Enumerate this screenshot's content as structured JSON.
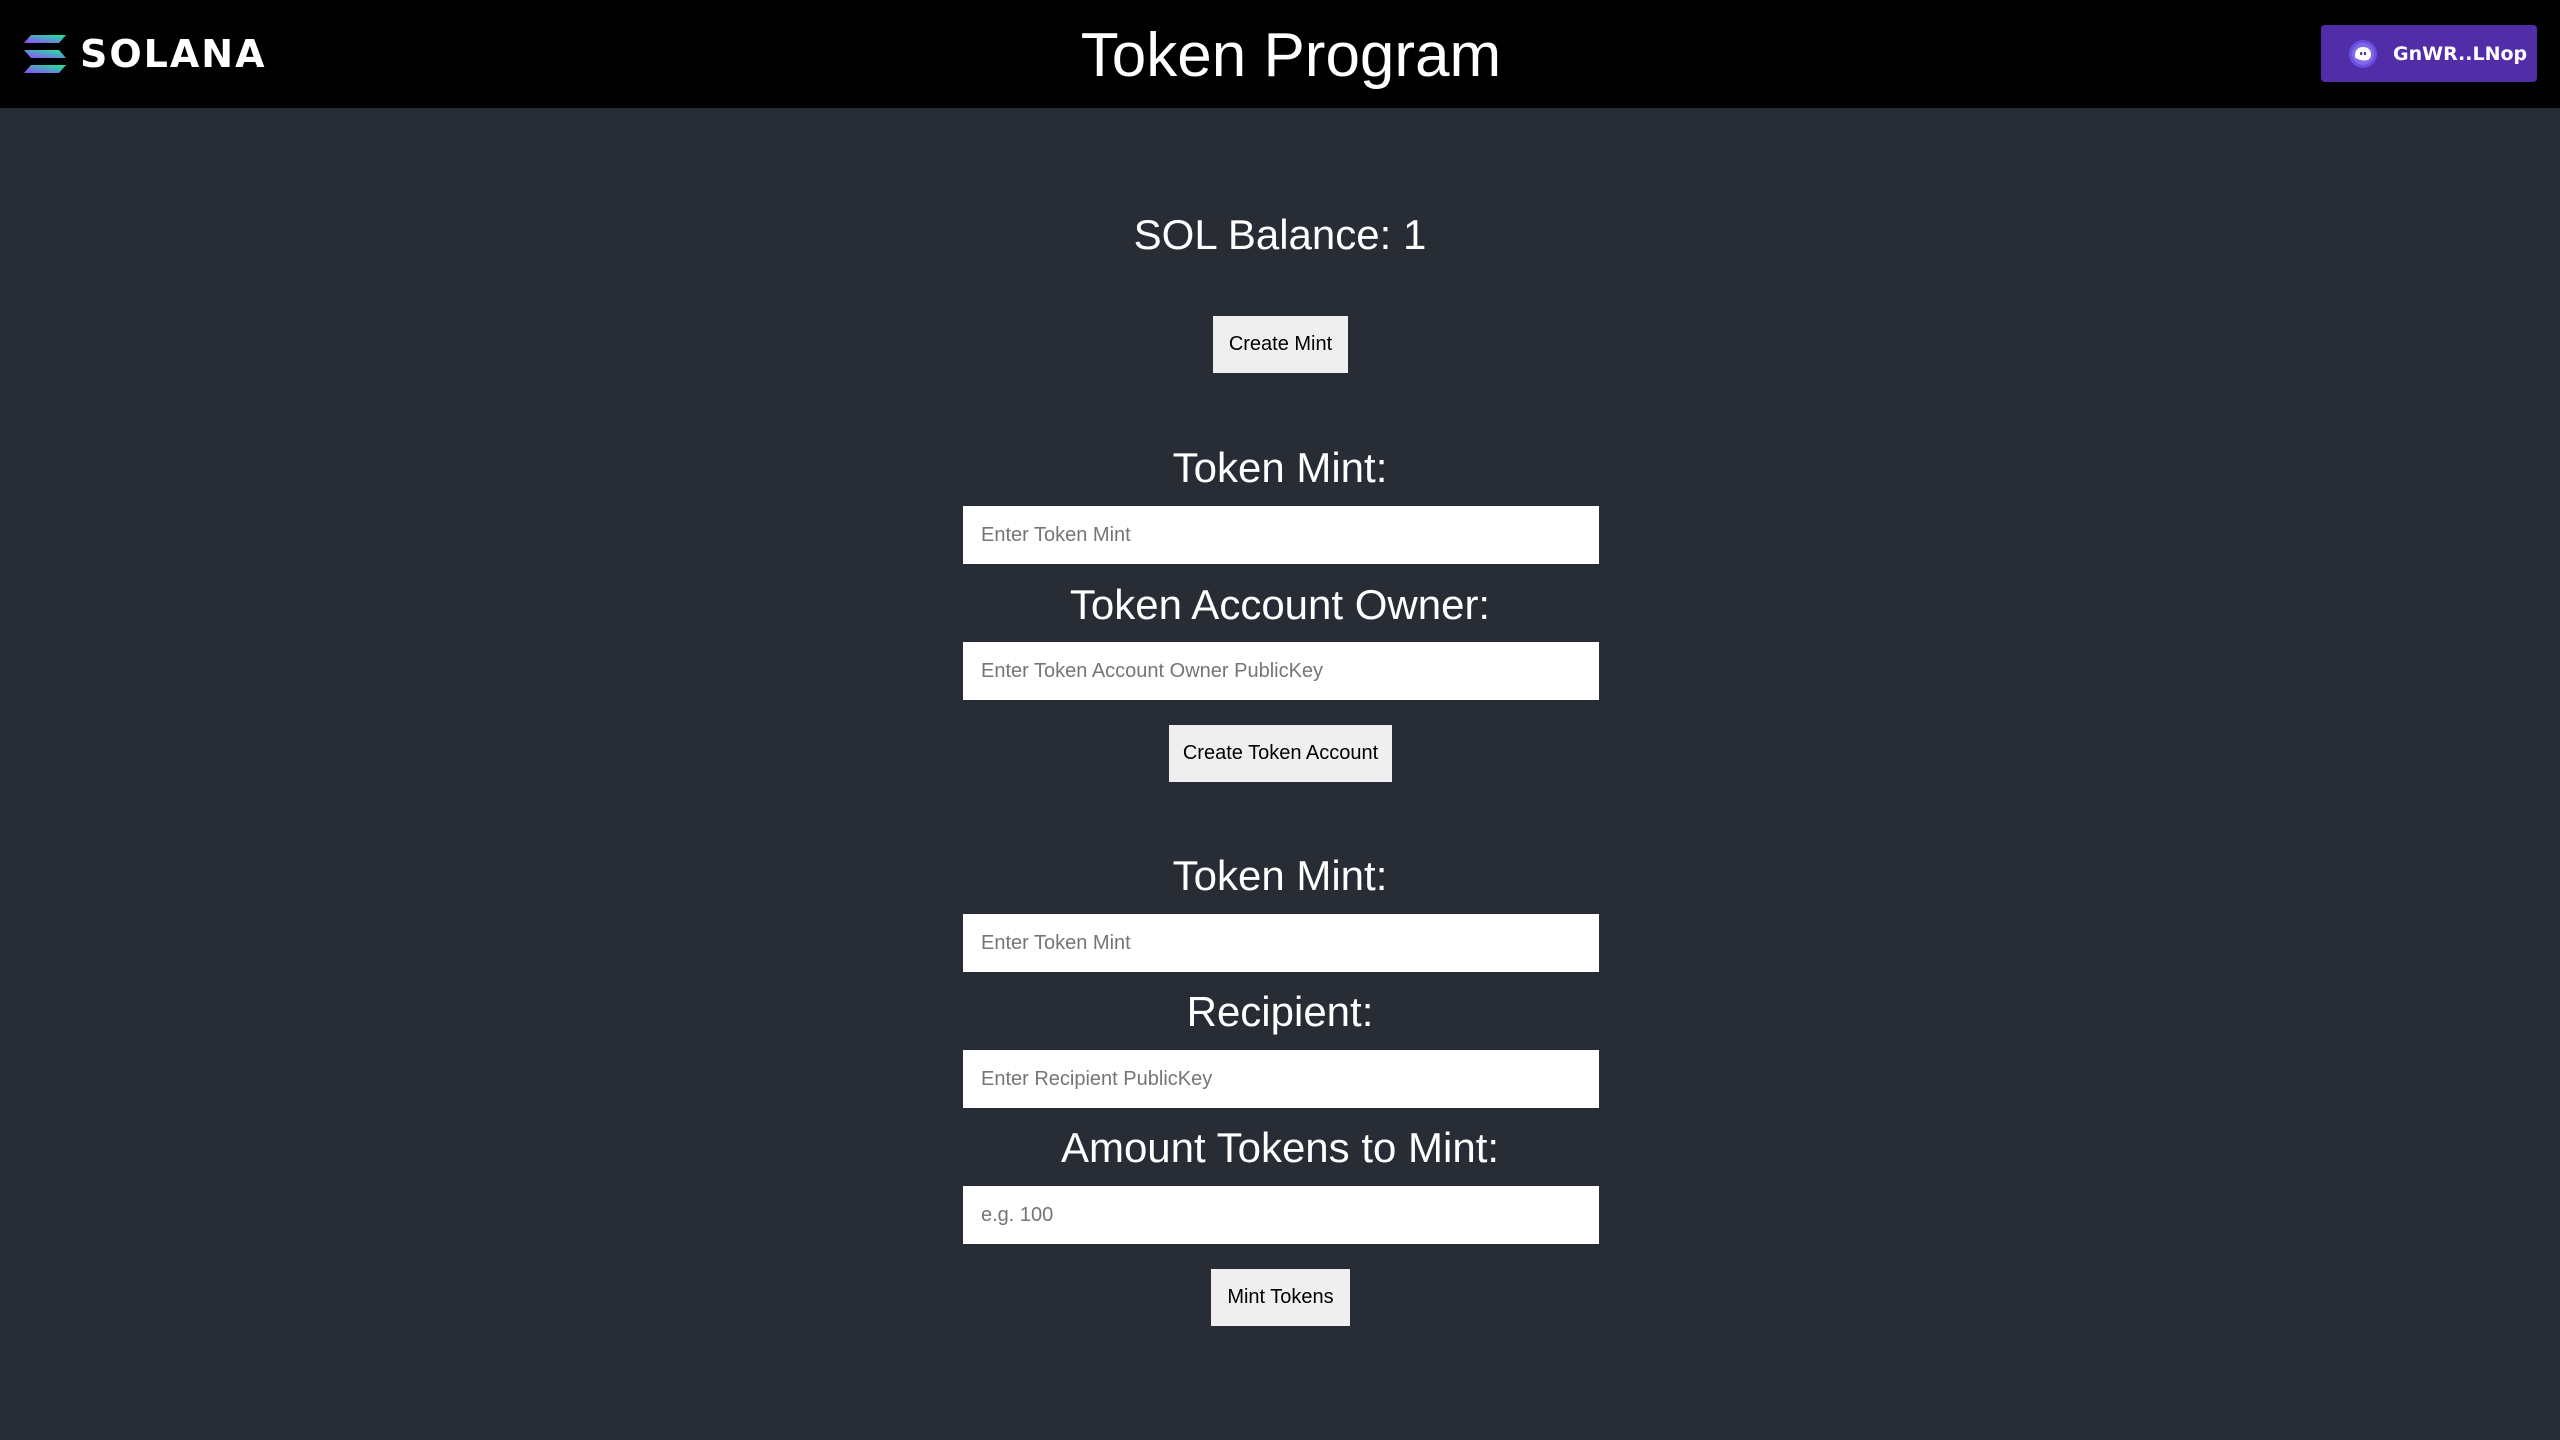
{
  "header": {
    "logo_text": "SOLANA",
    "title": "Token Program",
    "wallet": {
      "label": "GnWR..LNop",
      "icon": "phantom-wallet-icon",
      "color": "#512da8"
    }
  },
  "balance": {
    "text": "SOL Balance: 1"
  },
  "create_mint": {
    "button_label": "Create Mint"
  },
  "create_token_account": {
    "mint_label": "Token Mint:",
    "mint_placeholder": "Enter Token Mint",
    "mint_value": "",
    "owner_label": "Token Account Owner:",
    "owner_placeholder": "Enter Token Account Owner PublicKey",
    "owner_value": "",
    "button_label": "Create Token Account"
  },
  "mint_tokens": {
    "mint_label": "Token Mint:",
    "mint_placeholder": "Enter Token Mint",
    "mint_value": "",
    "recipient_label": "Recipient:",
    "recipient_placeholder": "Enter Recipient PublicKey",
    "recipient_value": "",
    "amount_label": "Amount Tokens to Mint:",
    "amount_placeholder": "e.g. 100",
    "amount_value": "",
    "button_label": "Mint Tokens"
  },
  "colors": {
    "header_bg": "#000000",
    "page_bg": "#282c34",
    "button_bg": "#efefef",
    "logo_gradient_start": "#14f195",
    "logo_gradient_end": "#9945ff"
  }
}
